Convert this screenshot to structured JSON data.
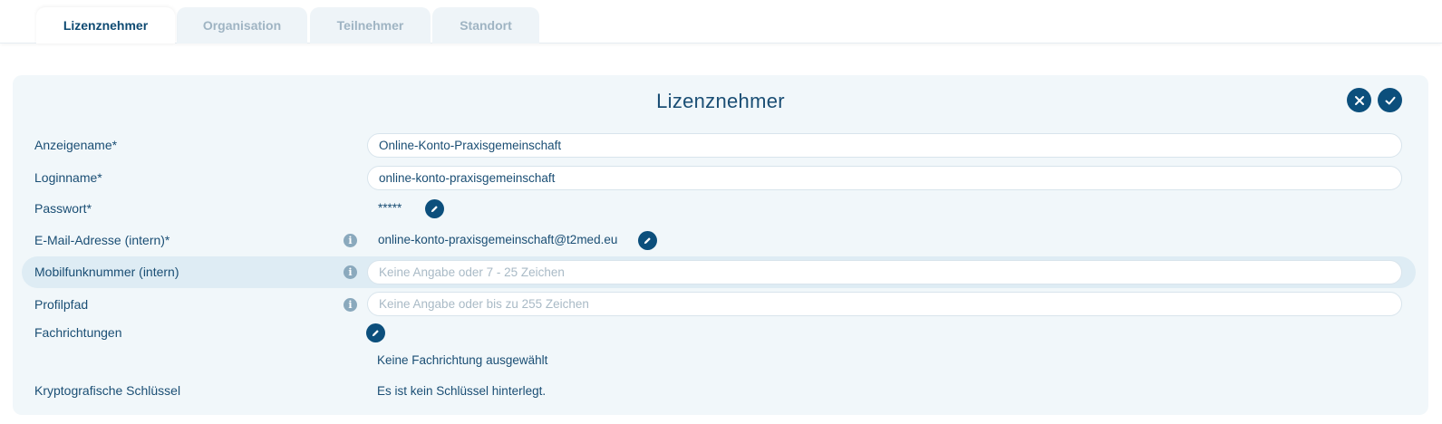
{
  "tabs": [
    {
      "label": "Lizenznehmer",
      "active": true
    },
    {
      "label": "Organisation",
      "active": false
    },
    {
      "label": "Teilnehmer",
      "active": false
    },
    {
      "label": "Standort",
      "active": false
    }
  ],
  "panel": {
    "title": "Lizenznehmer",
    "cancel_icon": "close-icon",
    "confirm_icon": "check-icon"
  },
  "form": {
    "display_name": {
      "label": "Anzeigename*",
      "value": "Online-Konto-Praxisgemeinschaft"
    },
    "login_name": {
      "label": "Loginname*",
      "value": "online-konto-praxisgemeinschaft"
    },
    "password": {
      "label": "Passwort*",
      "value": "*****"
    },
    "email": {
      "label": "E-Mail-Adresse (intern)*",
      "value": "online-konto-praxisgemeinschaft@t2med.eu"
    },
    "mobile": {
      "label": "Mobilfunknummer (intern)",
      "value": "",
      "placeholder": "Keine Angabe oder 7 - 25 Zeichen"
    },
    "profile_path": {
      "label": "Profilpfad",
      "value": "",
      "placeholder": "Keine Angabe oder bis zu 255 Zeichen"
    },
    "specialties": {
      "label": "Fachrichtungen",
      "value": "Keine Fachrichtung ausgewählt"
    },
    "crypto_keys": {
      "label": "Kryptografische Schlüssel",
      "value": "Es ist kein Schlüssel hinterlegt."
    }
  },
  "colors": {
    "accent": "#0c4f7c",
    "panel_bg": "#f1f7fa",
    "highlight_row": "#deecf4",
    "inactive_tab_text": "#9fb4c3"
  }
}
